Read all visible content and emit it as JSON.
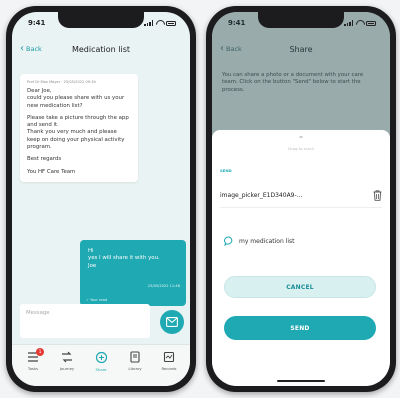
{
  "status": {
    "time": "9:41"
  },
  "left": {
    "back_label": "Back",
    "title": "Medication list",
    "incoming": {
      "meta": "Prof Dr Max Mayer · 25/05/2022 09:34",
      "lines": [
        "Dear Joe,\ncould you please share with us your new medication list?",
        "Please take a picture through the app and send it.\nThank you very much and please keep on doing your physical activity program.",
        "Best regards",
        "You HF Care Team"
      ]
    },
    "outgoing": {
      "text": "Hi\nyes I will share it with you.\nJoe",
      "time": "25/05/2022 11:48",
      "read": "✓ Your read"
    },
    "compose_placeholder": "Message",
    "tabs": [
      {
        "label": "Tasks",
        "icon": "tasks-icon",
        "badge": "1"
      },
      {
        "label": "Journey",
        "icon": "journey-icon"
      },
      {
        "label": "Share",
        "icon": "share-icon",
        "active": true
      },
      {
        "label": "Library",
        "icon": "library-icon"
      },
      {
        "label": "Records",
        "icon": "records-icon"
      }
    ]
  },
  "right": {
    "back_label": "Back",
    "title": "Share",
    "intro": "You can share a photo or a document with your care team. Click on the button \"Send\" below to start the process.",
    "drag_hint": "Drag to scroll",
    "send_section_label": "SEND",
    "file_name": "image_picker_E1D340A9-...",
    "caption": "my medication list",
    "cancel_label": "CANCEL",
    "send_label": "SEND"
  },
  "colors": {
    "accent": "#1fa9b2",
    "badge": "#e53935",
    "background": "#eaf3f3"
  }
}
